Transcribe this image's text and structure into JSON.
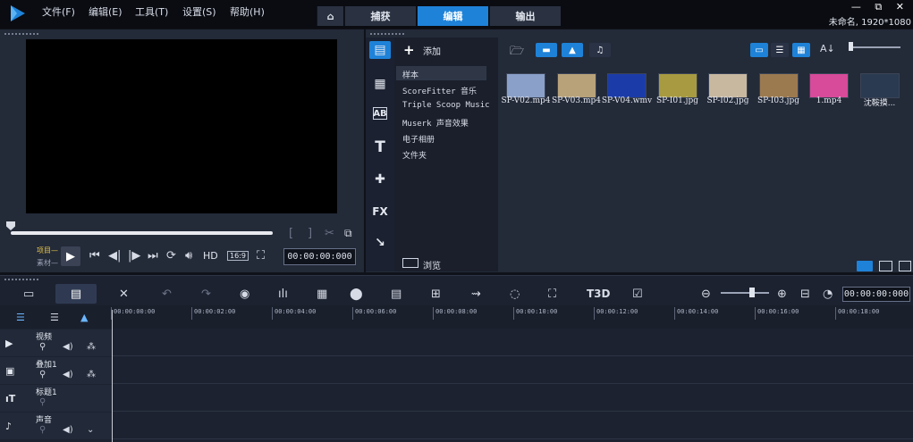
{
  "menu": {
    "file": "文件(F)",
    "edit": "编辑(E)",
    "tools": "工具(T)",
    "settings": "设置(S)",
    "help": "帮助(H)"
  },
  "tabs": {
    "capture": "捕获",
    "edit": "编辑",
    "output": "输出"
  },
  "window": {
    "controls": "— ⧉ ✕",
    "project": "未命名, 1920*1080"
  },
  "player": {
    "label_project": "项目—",
    "label_clip": "素材—",
    "hd": "HD",
    "aspect": "16:9",
    "timecode": "00:00:00:000"
  },
  "library": {
    "add_label": "添加",
    "browse_label": "浏览",
    "folders": [
      "样本",
      "ScoreFitter 音乐",
      "Triple Scoop Music",
      "Muserk 声音效果",
      "电子相册",
      "文件夹"
    ],
    "media": [
      {
        "name": "SP-V02.mp4",
        "color": "#8aa0c8"
      },
      {
        "name": "SP-V03.mp4",
        "color": "#b8a27a"
      },
      {
        "name": "SP-V04.wmv",
        "color": "#1b3ca8"
      },
      {
        "name": "SP-I01.jpg",
        "color": "#a89a40"
      },
      {
        "name": "SP-I02.jpg",
        "color": "#c8b8a0"
      },
      {
        "name": "SP-I03.jpg",
        "color": "#9c7a50"
      },
      {
        "name": "1.mp4",
        "color": "#d84a9a"
      },
      {
        "name": "沈鞍摸...",
        "color": "#2a3a50"
      }
    ]
  },
  "timeline": {
    "timecode": "00:00:00:000",
    "ticks": [
      "00:00:00:00",
      "00:00:02:00",
      "00:00:04:00",
      "00:00:06:00",
      "00:00:08:00",
      "00:00:10:00",
      "00:00:12:00",
      "00:00:14:00",
      "00:00:16:00",
      "00:00:18:00"
    ],
    "tracks": [
      {
        "label": "视频",
        "icon": "video-track-icon"
      },
      {
        "label": "叠加1",
        "icon": "overlay-track-icon"
      },
      {
        "label": "标题1",
        "icon": "title-track-icon"
      },
      {
        "label": "声音",
        "icon": "voice-track-icon"
      }
    ]
  },
  "colors": {
    "accent": "#1e82d8",
    "panel": "#232a38",
    "background": "#0f1219"
  }
}
